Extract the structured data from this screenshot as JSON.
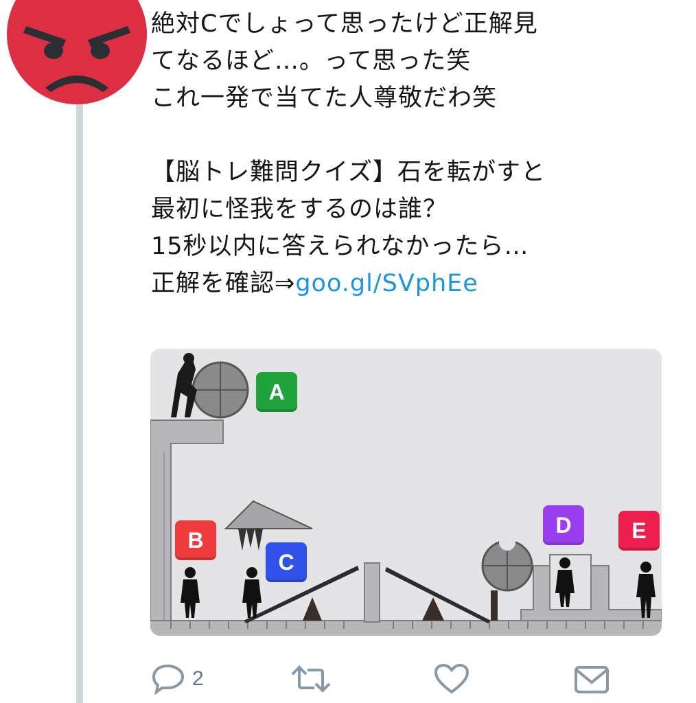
{
  "tweet": {
    "lines": [
      "絶対Cでしょって思ったけど正解見",
      "てなるほど…。って思った笑",
      "これ一発で当てた人尊敬だわ笑"
    ],
    "quiz_lines": [
      "【脳トレ難問クイズ】石を転がすと",
      "最初に怪我をするのは誰？",
      "15秒以内に答えられなかったら…"
    ],
    "link_prefix": "正解を確認⇒",
    "link_text": "goo.gl/SVphEe"
  },
  "avatar": {
    "icon": "angry-face-emoji",
    "color": "#dd2e44"
  },
  "media": {
    "labels": [
      {
        "text": "A",
        "color": "#1fa33a"
      },
      {
        "text": "B",
        "color": "#ee3b3b"
      },
      {
        "text": "C",
        "color": "#2f52e8"
      },
      {
        "text": "D",
        "color": "#9a3ff0"
      },
      {
        "text": "E",
        "color": "#ec1f4e"
      }
    ]
  },
  "actions": {
    "reply_count": "2",
    "link_color": "#1b95e0",
    "icons": [
      "reply-icon",
      "retweet-icon",
      "like-icon",
      "direct-message-icon"
    ]
  }
}
